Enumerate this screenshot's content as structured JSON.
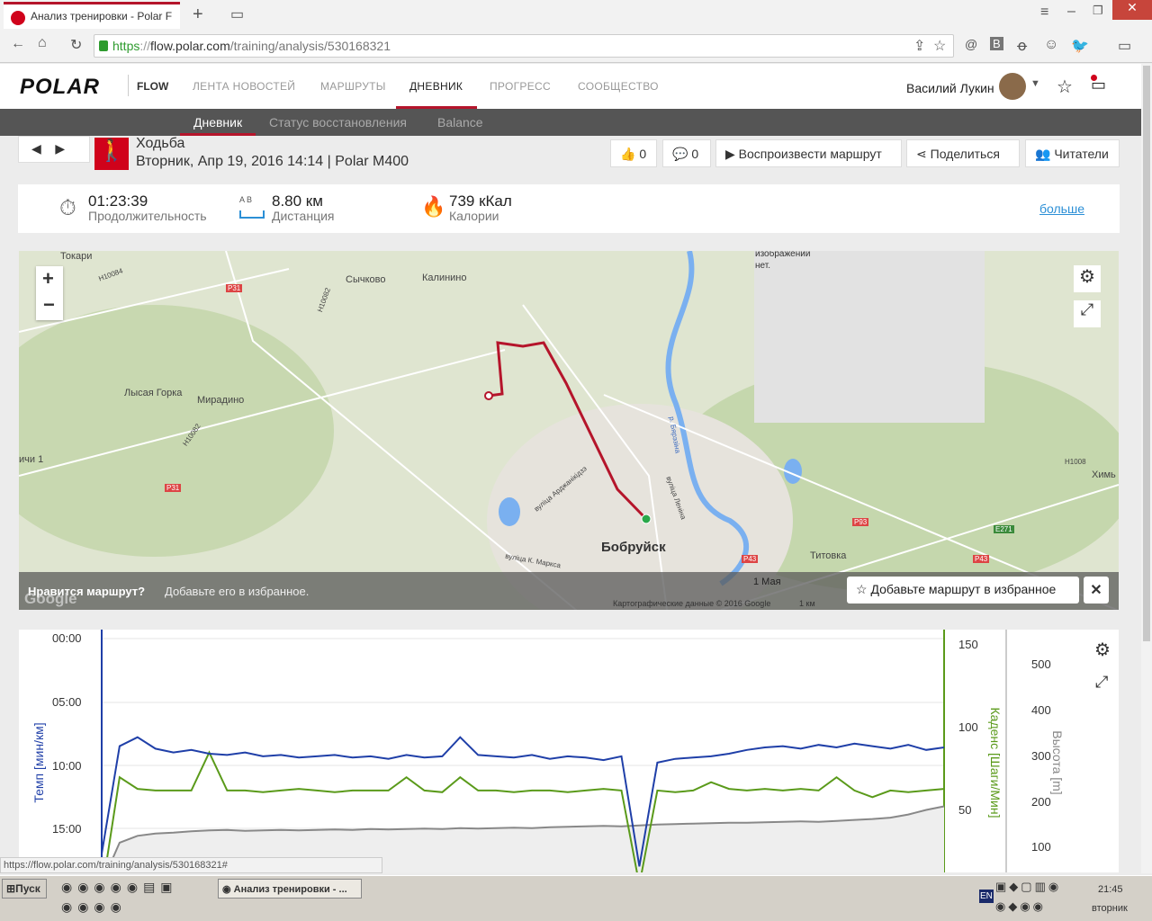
{
  "browser": {
    "tab_title": "Анализ тренировки - Polar F",
    "url_scheme": "https",
    "url_host": "flow.polar.com",
    "url_path": "/training/analysis/530168321",
    "status_url": "https://flow.polar.com/training/analysis/530168321#"
  },
  "nav": {
    "logo": "POLAR",
    "product": "FLOW",
    "items": [
      "ЛЕНТА НОВОСТЕЙ",
      "МАРШРУТЫ",
      "ДНЕВНИК",
      "ПРОГРЕСС",
      "СООБЩЕСТВО"
    ],
    "active": "ДНЕВНИК",
    "user": "Василий Лукин"
  },
  "subnav": {
    "items": [
      "Дневник",
      "Статус восстановления",
      "Balance"
    ],
    "active": "Дневник"
  },
  "session": {
    "sport": "Ходьба",
    "datetime": "Вторник, Апр 19, 2016 14:14 | Polar M400",
    "likes": "0",
    "comments": "0",
    "replay": "Воспроизвести маршрут",
    "share": "Поделиться",
    "readers": "Читатели"
  },
  "summary": {
    "duration": "01:23:39",
    "duration_label": "Продолжительность",
    "distance": "8.80 км",
    "distance_label": "Дистанция",
    "ab": "A  B",
    "calories": "739 кКал",
    "calories_label": "Калории",
    "more": "больше"
  },
  "map": {
    "labels": [
      "Токари",
      "Сычково",
      "Калинино",
      "Лысая Горка",
      "Мирадино",
      "Бобруйск",
      "Титовка",
      "1 Мая",
      "Химь",
      "ичи 1",
      "изображений нет."
    ],
    "roads": [
      "Р31",
      "Р31",
      "Н10084",
      "Н10082",
      "Н10082",
      "Р93",
      "Р43",
      "Р43",
      "Е271",
      "Н1008"
    ],
    "streets": [
      "вуліца Арджанікідзэ",
      "вуліца Леніна",
      "р. Бярэзіна",
      "вуліца К. Маркса"
    ],
    "promo_q": "Нравится маршрут?",
    "promo_text": "Добавьте его в избранное.",
    "add_fav": "Добавьте маршрут в избранное",
    "attribution": "Картографические данные © 2016 Google",
    "scale": "1 км",
    "google": "Google"
  },
  "chart_data": {
    "type": "line",
    "pace": {
      "label": "Темп [мин/км]",
      "ticks": [
        "00:00",
        "05:00",
        "10:00",
        "15:00"
      ],
      "range": [
        0,
        18
      ],
      "values": [
        17,
        8.5,
        7.8,
        8.7,
        9.0,
        8.8,
        9.1,
        9.2,
        9.0,
        9.3,
        9.2,
        9.4,
        9.3,
        9.2,
        9.4,
        9.3,
        9.5,
        9.2,
        9.4,
        9.3,
        7.8,
        9.2,
        9.3,
        9.4,
        9.2,
        9.5,
        9.3,
        9.4,
        9.6,
        9.3,
        18,
        9.8,
        9.5,
        9.4,
        9.3,
        9.1,
        8.8,
        8.6,
        8.5,
        8.7,
        8.4,
        8.6,
        8.3,
        8.5,
        8.7,
        8.4,
        8.8,
        8.6
      ],
      "color": "#1f3fa8"
    },
    "cadence": {
      "label": "Каденс [Шаги/Мин]",
      "ticks": [
        "150",
        "100",
        "50"
      ],
      "range": [
        0,
        150
      ],
      "values": [
        0,
        70,
        63,
        62,
        62,
        62,
        85,
        62,
        62,
        61,
        62,
        63,
        62,
        61,
        62,
        62,
        62,
        70,
        62,
        61,
        70,
        62,
        62,
        61,
        62,
        62,
        61,
        62,
        63,
        62,
        5,
        62,
        61,
        62,
        67,
        63,
        62,
        63,
        62,
        63,
        62,
        70,
        62,
        58,
        62,
        61,
        62,
        63
      ],
      "color": "#5a9a1a"
    },
    "altitude": {
      "label": "Высота [m]",
      "ticks": [
        "500",
        "400",
        "300",
        "200",
        "100"
      ],
      "range": [
        0,
        560
      ],
      "values": [
        20,
        110,
        125,
        130,
        132,
        135,
        137,
        138,
        136,
        137,
        138,
        137,
        138,
        139,
        138,
        140,
        139,
        140,
        141,
        140,
        142,
        141,
        142,
        143,
        142,
        144,
        145,
        146,
        147,
        146,
        148,
        150,
        151,
        152,
        153,
        154,
        154,
        155,
        156,
        157,
        156,
        158,
        160,
        162,
        165,
        172,
        182,
        190
      ],
      "color": "#888888"
    }
  },
  "taskbar": {
    "start": "Пуск",
    "window": "Анализ тренировки - ...",
    "lang": "EN",
    "time": "21:45",
    "day": "вторник"
  }
}
